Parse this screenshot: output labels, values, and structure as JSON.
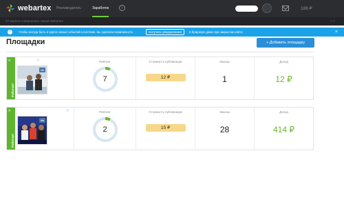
{
  "header": {
    "logo_text": "webartex",
    "nav": [
      {
        "label": "Рекламодатель",
        "active": false
      },
      {
        "label": "Заработок",
        "active": true
      }
    ],
    "balance": "186 ₽"
  },
  "news": {
    "text": "27 апреля  Совершенно новый Webartex",
    "arrows": "‹   ›"
  },
  "notice": {
    "text_before": "Чтобы всегда быть в курсе новых событий в системе, вы сделали возможность",
    "button": "получать уведомления",
    "text_after": "в браузере даже при закрытом сайте",
    "close": "×"
  },
  "page": {
    "title": "Площадки",
    "add_button": "+ Добавить площадку"
  },
  "sites": [
    {
      "status": "Работает",
      "rating_label": "Рейтинг",
      "rating": "7",
      "rating_fraction": 0.07,
      "price_label": "Стоимость публикации",
      "price": "12 ₽",
      "orders_label": "Заказы",
      "orders": "1",
      "income_label": "Доход",
      "income": "12 ₽"
    },
    {
      "status": "Работает",
      "rating_label": "Рейтинг",
      "rating": "2",
      "rating_fraction": 0.07,
      "price_label": "Стоимость публикации",
      "price": "15 ₽",
      "orders_label": "Заказы",
      "orders": "28",
      "income_label": "Доход",
      "income": "414 ₽"
    }
  ],
  "colors": {
    "accent_green": "#6cb531",
    "accent_blue": "#2b8fd8",
    "notice_blue": "#1aa3e8",
    "price_yellow": "#f7d88a",
    "ring_track": "#d6e6f4"
  }
}
